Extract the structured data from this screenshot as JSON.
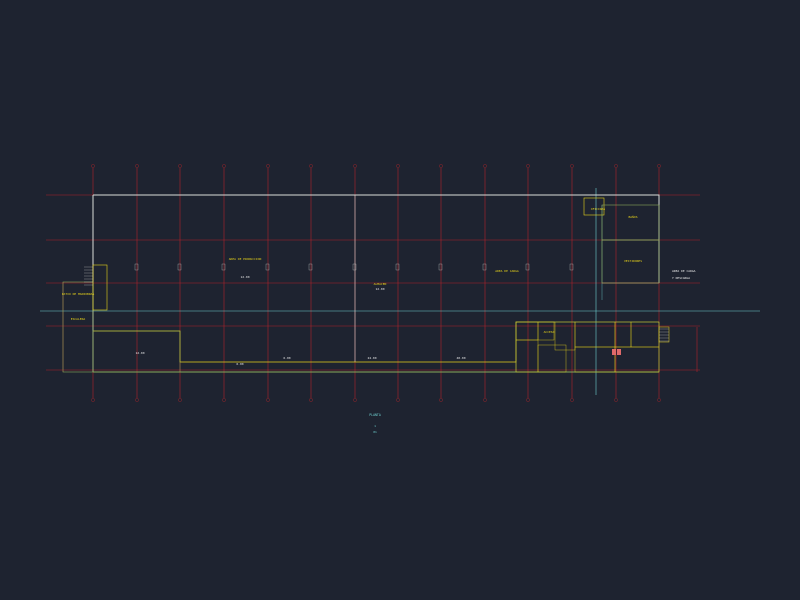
{
  "drawing": {
    "background": "#1e2330",
    "colors": {
      "grid_red": "#b0232a",
      "wall_white": "#d9dcd8",
      "wall_yellow": "#e6d21a",
      "wall_green": "#8ba85a",
      "axis_cyan": "#6fd0d0",
      "room_red_fill": "#e06a6a",
      "text_white": "#e8e8e8",
      "text_yellow": "#e6d21a"
    },
    "title_block": {
      "title": "PLANTA",
      "line2": "1",
      "line3": "01"
    },
    "room_labels": [
      {
        "text": "AREA DE PRODUCCION"
      },
      {
        "text": "ALMACEN"
      },
      {
        "text": "AREA DE CARGA"
      },
      {
        "text": "OFICINAS"
      },
      {
        "text": "BAÑOS"
      },
      {
        "text": "VESTIDORES"
      },
      {
        "text": "ACCESO"
      },
      {
        "text": "ESCALERA"
      },
      {
        "text": "PATIO DE MANIOBRAS"
      }
    ],
    "notes": [
      {
        "text": "AREA DE CARGA"
      },
      {
        "text": "Y DESCARGA"
      }
    ],
    "dimension_labels": [
      "12.00",
      "12.00",
      "12.00",
      "6.00",
      "6.00",
      "24.00",
      "48.00"
    ]
  }
}
